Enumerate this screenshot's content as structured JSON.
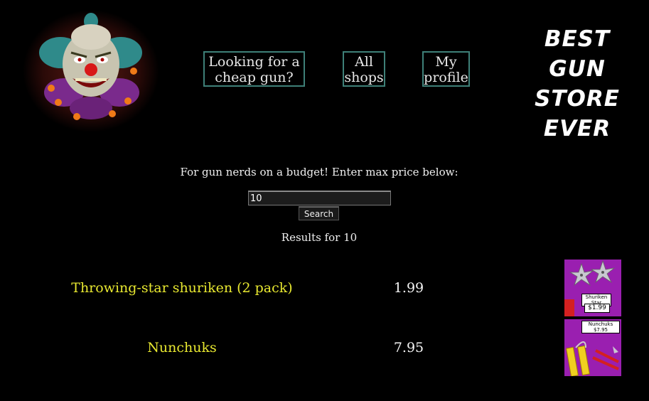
{
  "nav": {
    "cheap_gun": "Looking for a cheap gun?",
    "all_shops": "All shops",
    "my_profile": "My profile"
  },
  "brand": {
    "line1": "BEST",
    "line2": "GUN STORE",
    "line3": "EVER"
  },
  "search": {
    "intro": "For gun nerds on a budget! Enter max price below:",
    "value": "10",
    "button_label": "Search",
    "results_heading": "Results for 10"
  },
  "results": [
    {
      "name": "Throwing-star shuriken (2 pack)",
      "price": "1.99",
      "thumb_label": "Shuriken Star",
      "thumb_price": "$1.99"
    },
    {
      "name": "Nunchuks",
      "price": "7.95",
      "thumb_label": "Nunchuks",
      "thumb_price": "$7.95"
    }
  ],
  "colors": {
    "background": "#000000",
    "nav_border": "#3e8078",
    "product_name": "#e8e830",
    "thumb_bg": "#9a1fb0"
  },
  "icons": {
    "logo": "clown-logo-icon"
  }
}
